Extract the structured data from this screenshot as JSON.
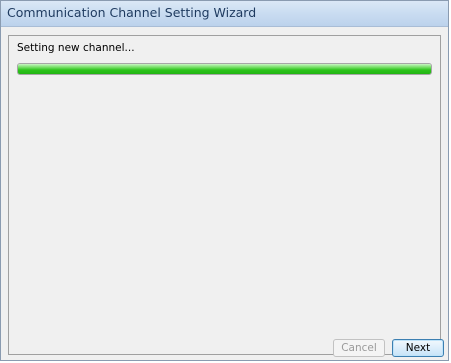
{
  "window": {
    "title": "Communication Channel Setting Wizard"
  },
  "main": {
    "status_text": "Setting new channel...",
    "progress": {
      "fraction": 1.0,
      "color": "#2cc31b"
    }
  },
  "buttons": {
    "cancel_label": "Cancel",
    "cancel_enabled": false,
    "next_label": "Next",
    "next_enabled": true
  }
}
